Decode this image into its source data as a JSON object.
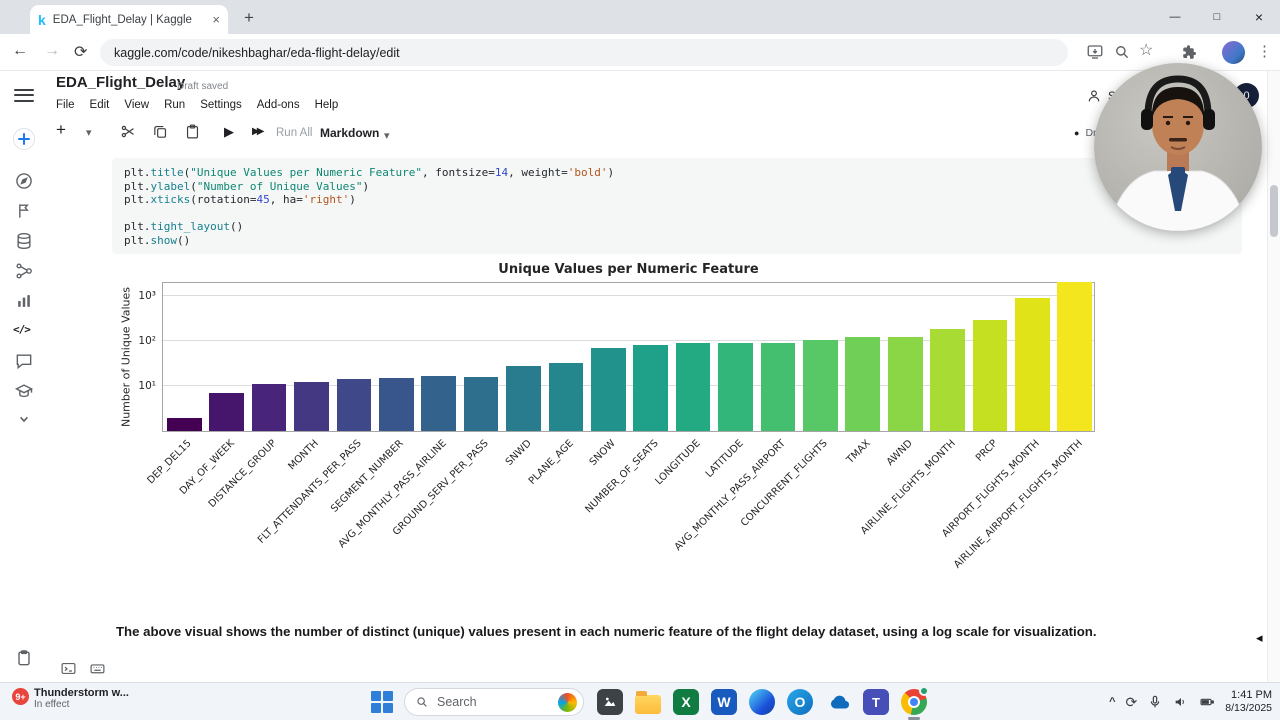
{
  "browser": {
    "tab_title": "EDA_Flight_Delay | Kaggle",
    "url": "kaggle.com/code/nikeshbaghar/eda-flight-delay/edit"
  },
  "icons": {
    "close": "×",
    "minimize": "—",
    "maximize": "□",
    "new_tab": "+",
    "back": "←",
    "forward": "→",
    "reload": "⟳",
    "star": "☆",
    "kebab": "⋮",
    "plus": "+",
    "caret": "▾",
    "play": "▶",
    "ff": "▶▶",
    "dot": "●",
    "collapse": "◂",
    "tray_chevron": "^",
    "sync": "⟳",
    "code_rail": "</>",
    "excel": "X",
    "word": "W",
    "outlook": "O",
    "teams": "T"
  },
  "kaggle": {
    "title": "EDA_Flight_Delay",
    "status": "Draft saved",
    "menus": [
      "File",
      "Edit",
      "View",
      "Run",
      "Settings",
      "Add-ons",
      "Help"
    ],
    "share_label": "Share",
    "notification_count": "0",
    "toolbar": {
      "run_all": "Run All",
      "cell_type": "Markdown",
      "session": "Draft Session"
    },
    "note": "The above visual shows the number of distinct (unique) values present in each numeric feature of the flight delay dataset, using a log scale for visualization."
  },
  "code": {
    "lines": [
      [
        [
          "p",
          "plt."
        ],
        [
          "m",
          "title"
        ],
        [
          "p",
          "("
        ],
        [
          "s",
          "\"Unique Values per Numeric Feature\""
        ],
        [
          "p",
          ", fontsize="
        ],
        [
          "n",
          "14"
        ],
        [
          "p",
          ", weight="
        ],
        [
          "q",
          "'bold'"
        ],
        [
          "p",
          ")"
        ]
      ],
      [
        [
          "p",
          "plt."
        ],
        [
          "m",
          "ylabel"
        ],
        [
          "p",
          "("
        ],
        [
          "s",
          "\"Number of Unique Values\""
        ],
        [
          "p",
          ")"
        ]
      ],
      [
        [
          "p",
          "plt."
        ],
        [
          "m",
          "xticks"
        ],
        [
          "p",
          "(rotation="
        ],
        [
          "n",
          "45"
        ],
        [
          "p",
          ", ha="
        ],
        [
          "q",
          "'right'"
        ],
        [
          "p",
          ")"
        ]
      ],
      [],
      [
        [
          "p",
          "plt."
        ],
        [
          "m",
          "tight_layout"
        ],
        [
          "p",
          "()"
        ]
      ],
      [
        [
          "p",
          "plt."
        ],
        [
          "m",
          "show"
        ],
        [
          "p",
          "()"
        ]
      ]
    ]
  },
  "chart_data": {
    "type": "bar",
    "title": "Unique Values per Numeric Feature",
    "xlabel": "",
    "ylabel": "Number of Unique Values",
    "yscale": "log",
    "ylim": [
      1,
      3000
    ],
    "grid": true,
    "yticks": [
      {
        "label": "10¹",
        "exp": 1
      },
      {
        "label": "10²",
        "exp": 2
      },
      {
        "label": "10³",
        "exp": 3
      }
    ],
    "categories": [
      "DEP_DEL15",
      "DAY_OF_WEEK",
      "DISTANCE_GROUP",
      "MONTH",
      "FLT_ATTENDANTS_PER_PASS",
      "SEGMENT_NUMBER",
      "AVG_MONTHLY_PASS_AIRLINE",
      "GROUND_SERV_PER_PASS",
      "SNWD",
      "PLANE_AGE",
      "SNOW",
      "NUMBER_OF_SEATS",
      "LONGITUDE",
      "LATITUDE",
      "AVG_MONTHLY_PASS_AIRPORT",
      "CONCURRENT_FLIGHTS",
      "TMAX",
      "AWND",
      "AIRLINE_FLIGHTS_MONTH",
      "PRCP",
      "AIRPORT_FLIGHTS_MONTH",
      "AIRLINE_AIRPORT_FLIGHTS_MONTH"
    ],
    "values": [
      2,
      7,
      11,
      12,
      14,
      15,
      17,
      16,
      28,
      33,
      70,
      80,
      92,
      90,
      92,
      108,
      125,
      120,
      190,
      300,
      900,
      2100
    ],
    "colors": [
      "#440154",
      "#46156c",
      "#48247b",
      "#453882",
      "#3f4889",
      "#39568c",
      "#33638d",
      "#2e6f8e",
      "#297b8e",
      "#24878e",
      "#21928c",
      "#1fa088",
      "#24aa83",
      "#32b67a",
      "#44bf70",
      "#58c765",
      "#70cf57",
      "#8bd646",
      "#a8db34",
      "#c5e021",
      "#dfe318",
      "#f4e61e"
    ]
  },
  "taskbar": {
    "weather_badge": "9+",
    "weather_title": "Thunderstorm w...",
    "weather_subtitle": "In effect",
    "search_label": "Search",
    "time": "1:41 PM",
    "date": "8/13/2025"
  }
}
